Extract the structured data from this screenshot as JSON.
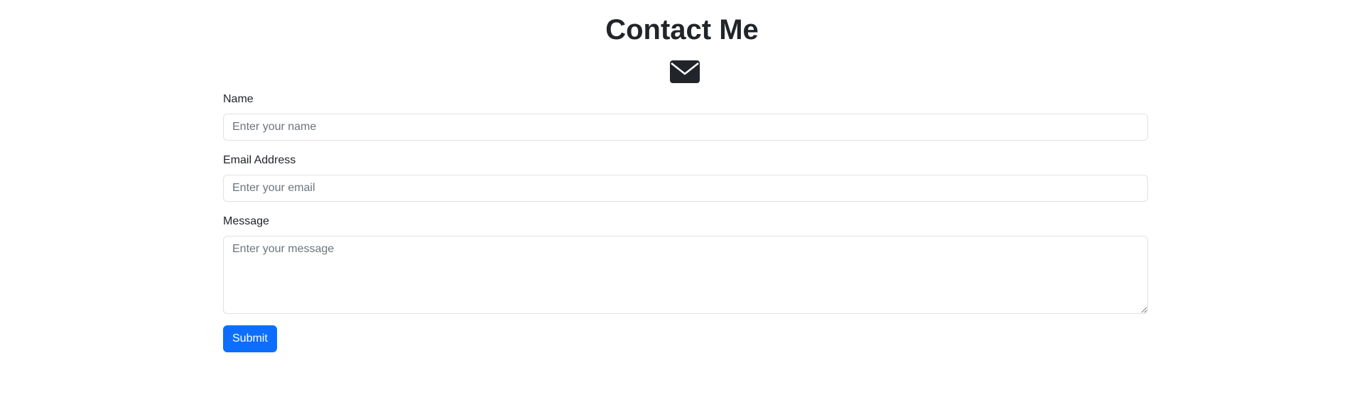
{
  "page": {
    "title": "Contact Me",
    "icon": "envelope-icon"
  },
  "form": {
    "name": {
      "label": "Name",
      "placeholder": "Enter your name",
      "value": ""
    },
    "email": {
      "label": "Email Address",
      "placeholder": "Enter your email",
      "value": ""
    },
    "message": {
      "label": "Message",
      "placeholder": "Enter your message",
      "value": ""
    },
    "submit_label": "Submit"
  },
  "colors": {
    "text": "#212529",
    "primary": "#0d6efd",
    "border": "#dee2e6",
    "placeholder": "#6c757d"
  }
}
